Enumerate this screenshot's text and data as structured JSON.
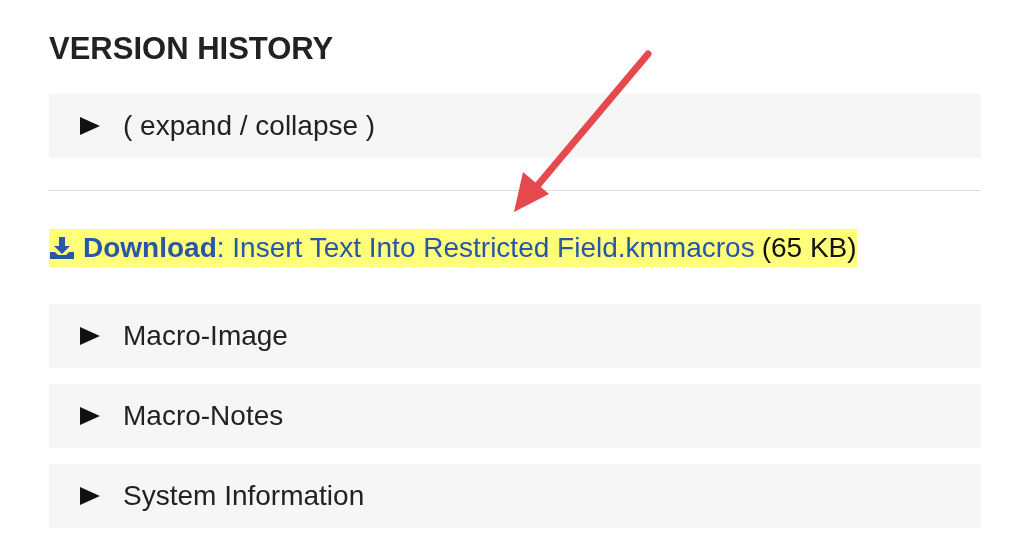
{
  "heading": "VERSION HISTORY",
  "top_section": {
    "label": "( expand / collapse )",
    "expanded": false
  },
  "download": {
    "link": "**Download**: Insert Text Into Restricted Field.kmmacros",
    "size": "(65 KB)"
  },
  "sections": [
    {
      "label": "Macro-Image",
      "expanded": false
    },
    {
      "label": "Macro-Notes",
      "expanded": false
    },
    {
      "label": "System Information",
      "expanded": false
    }
  ]
}
